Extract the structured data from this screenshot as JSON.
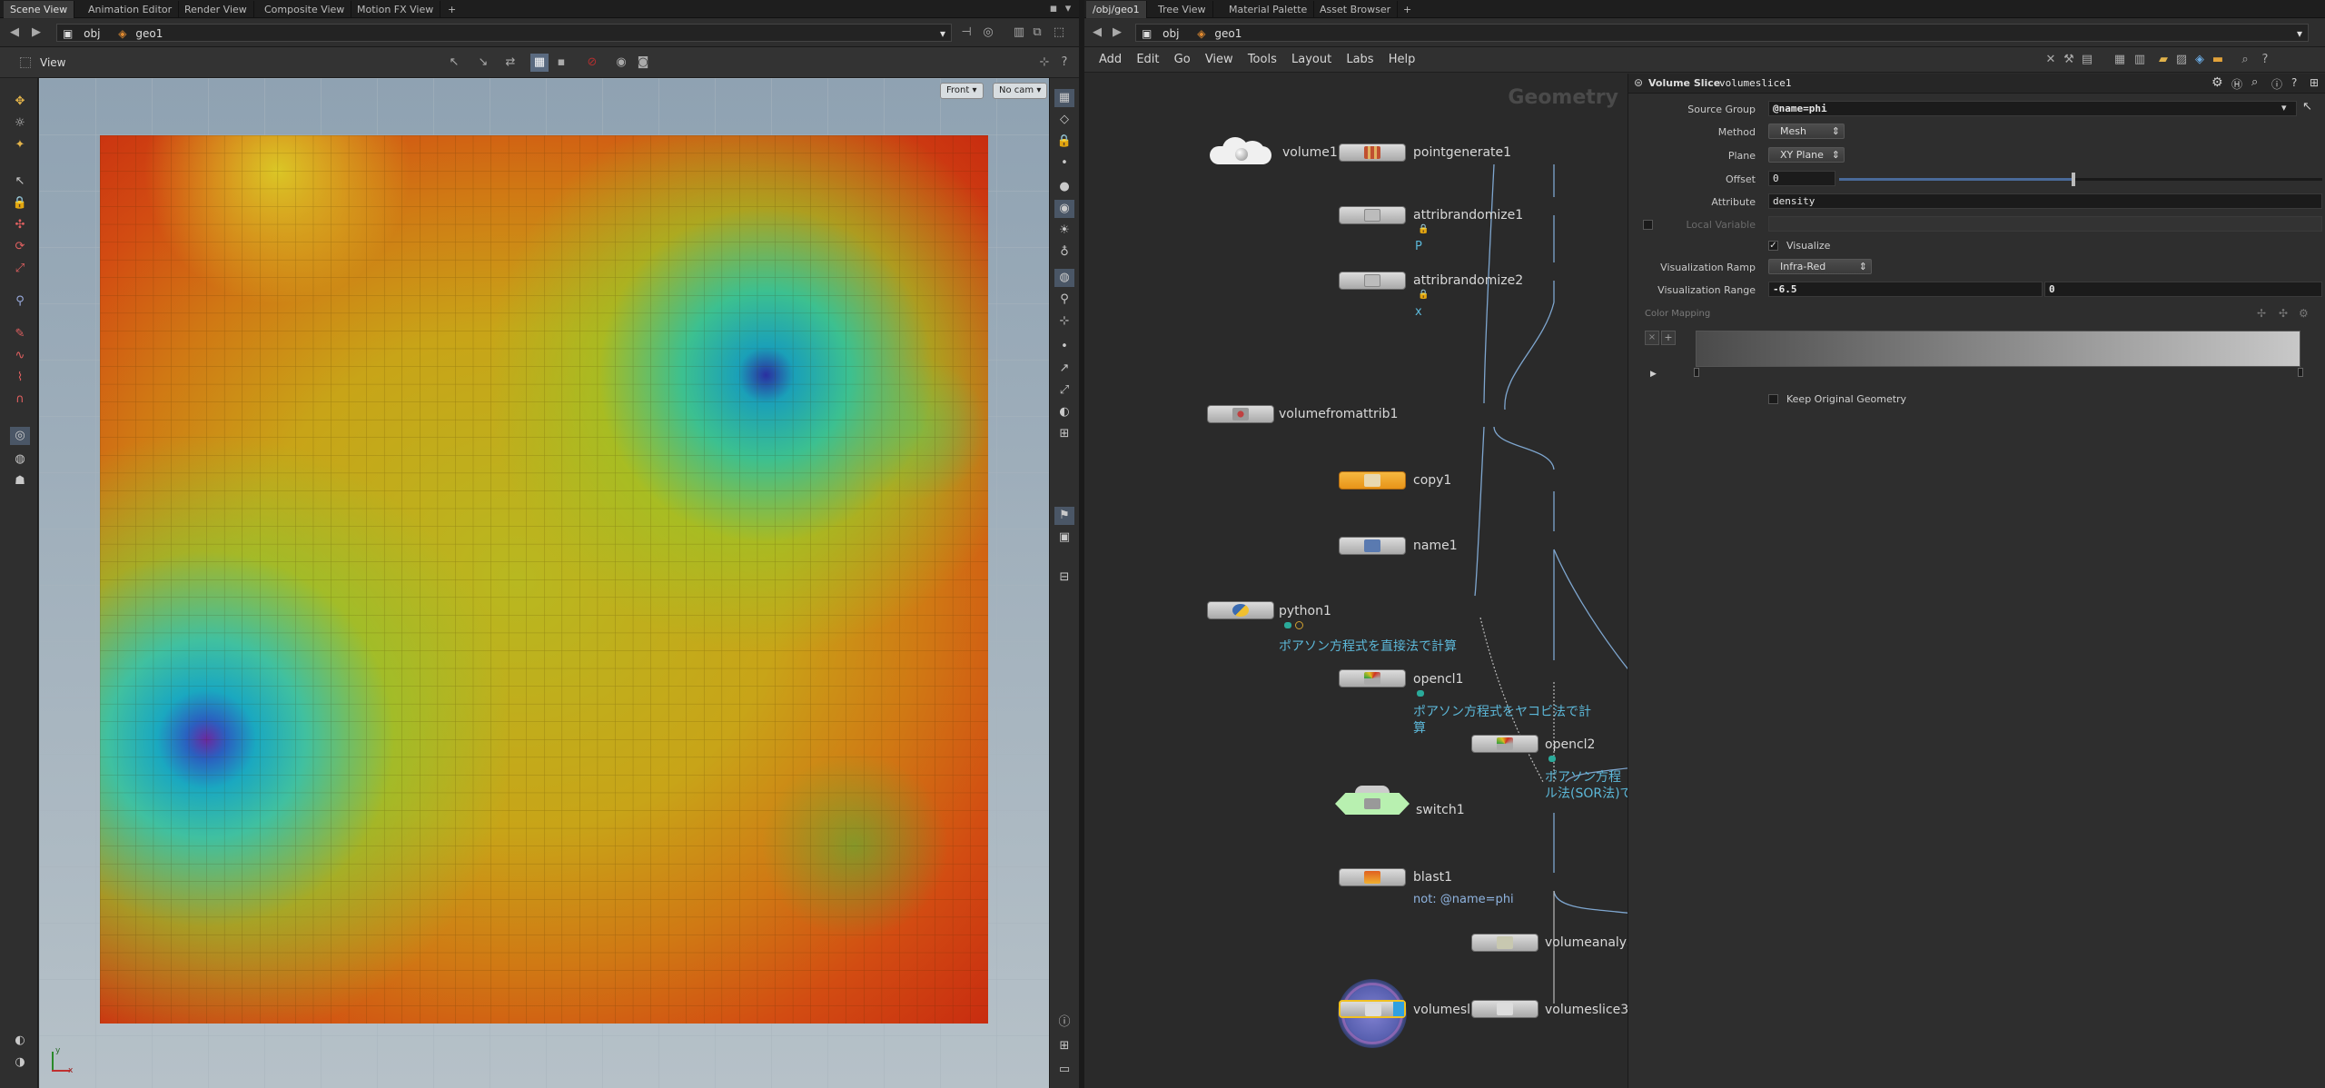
{
  "left_tabs": [
    "Scene View",
    "Animation Editor",
    "Render View",
    "Composite View",
    "Motion FX View"
  ],
  "right_tabs": [
    "/obj/geo1",
    "Tree View",
    "Material Palette",
    "Asset Browser"
  ],
  "left_path": [
    "obj",
    "geo1"
  ],
  "right_path": [
    "obj",
    "geo1"
  ],
  "viewport": {
    "title": "View",
    "camera_view": "Front",
    "camera": "No cam",
    "axis_x": "x",
    "axis_y": "y"
  },
  "network": {
    "menu": [
      "Add",
      "Edit",
      "Go",
      "View",
      "Tools",
      "Layout",
      "Labs",
      "Help"
    ],
    "context_label": "Geometry",
    "nodes": {
      "volume1": "volume1",
      "pointgenerate1": "pointgenerate1",
      "attribrandomize1": "attribrandomize1",
      "attribrandomize1_note": "P",
      "attribrandomize2": "attribrandomize2",
      "attribrandomize2_note": "x",
      "volumefromattrib1": "volumefromattrib1",
      "copy1": "copy1",
      "name1": "name1",
      "python1": "python1",
      "python1_comment": "ポアソン方程式を直接法で計算",
      "opencl1": "opencl1",
      "opencl1_comment_1": "ポアソン方程式をヤコビ法で計",
      "opencl1_comment_2": "算",
      "opencl2": "opencl2",
      "opencl2_comment_1": "ポアソン方程",
      "opencl2_comment_2": "ル法(SOR法)で",
      "switch1": "switch1",
      "blast1": "blast1",
      "blast1_note": "not: @name=phi",
      "volumeanalysis": "volumeanalys",
      "volumeslice1": "volumesli",
      "volumeslice3": "volumeslice3"
    }
  },
  "params": {
    "node_type": "Volume Slice",
    "node_name": "volumeslice1",
    "source_group_label": "Source Group",
    "source_group": "@name=phi",
    "method_label": "Method",
    "method": "Mesh",
    "plane_label": "Plane",
    "plane": "XY Plane",
    "offset_label": "Offset",
    "offset": "0",
    "attribute_label": "Attribute",
    "attribute": "density",
    "local_variable_label": "Local Variable",
    "visualize_label": "Visualize",
    "viz_ramp_label": "Visualization Ramp",
    "viz_ramp": "Infra-Red",
    "viz_range_label": "Visualization Range",
    "viz_range_min": "-6.5",
    "viz_range_max": "0",
    "color_mapping_label": "Color Mapping",
    "keep_original_label": "Keep Original Geometry"
  },
  "colors": {
    "accent_orange": "#f0a020",
    "link_blue": "#5cb8d9",
    "panel_bg": "#2b2b2b",
    "viewport_bg": "#9aaab6",
    "switch_green": "#b8f0b0"
  }
}
